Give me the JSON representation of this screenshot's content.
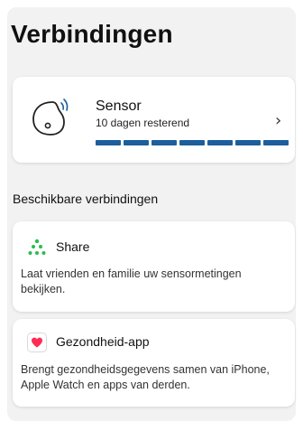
{
  "page": {
    "title": "Verbindingen"
  },
  "sensor": {
    "name": "Sensor",
    "status": "10 dagen resterend",
    "icon": "sensor-icon",
    "progress_segments_total": 7,
    "progress_segments_filled": 7,
    "accent_color": "#1d5f9c"
  },
  "available": {
    "label": "Beschikbare verbindingen",
    "items": [
      {
        "title": "Share",
        "description": "Laat vrienden en familie uw sensormetingen bekijken.",
        "icon": "share-icon",
        "icon_color": "#2dbb4e"
      },
      {
        "title": "Gezondheid-app",
        "description": "Brengt gezondheidsgegevens samen van iPhone,  Apple Watch en apps van derden.",
        "icon": "heart-icon",
        "icon_color": "#ff2d55"
      }
    ]
  }
}
